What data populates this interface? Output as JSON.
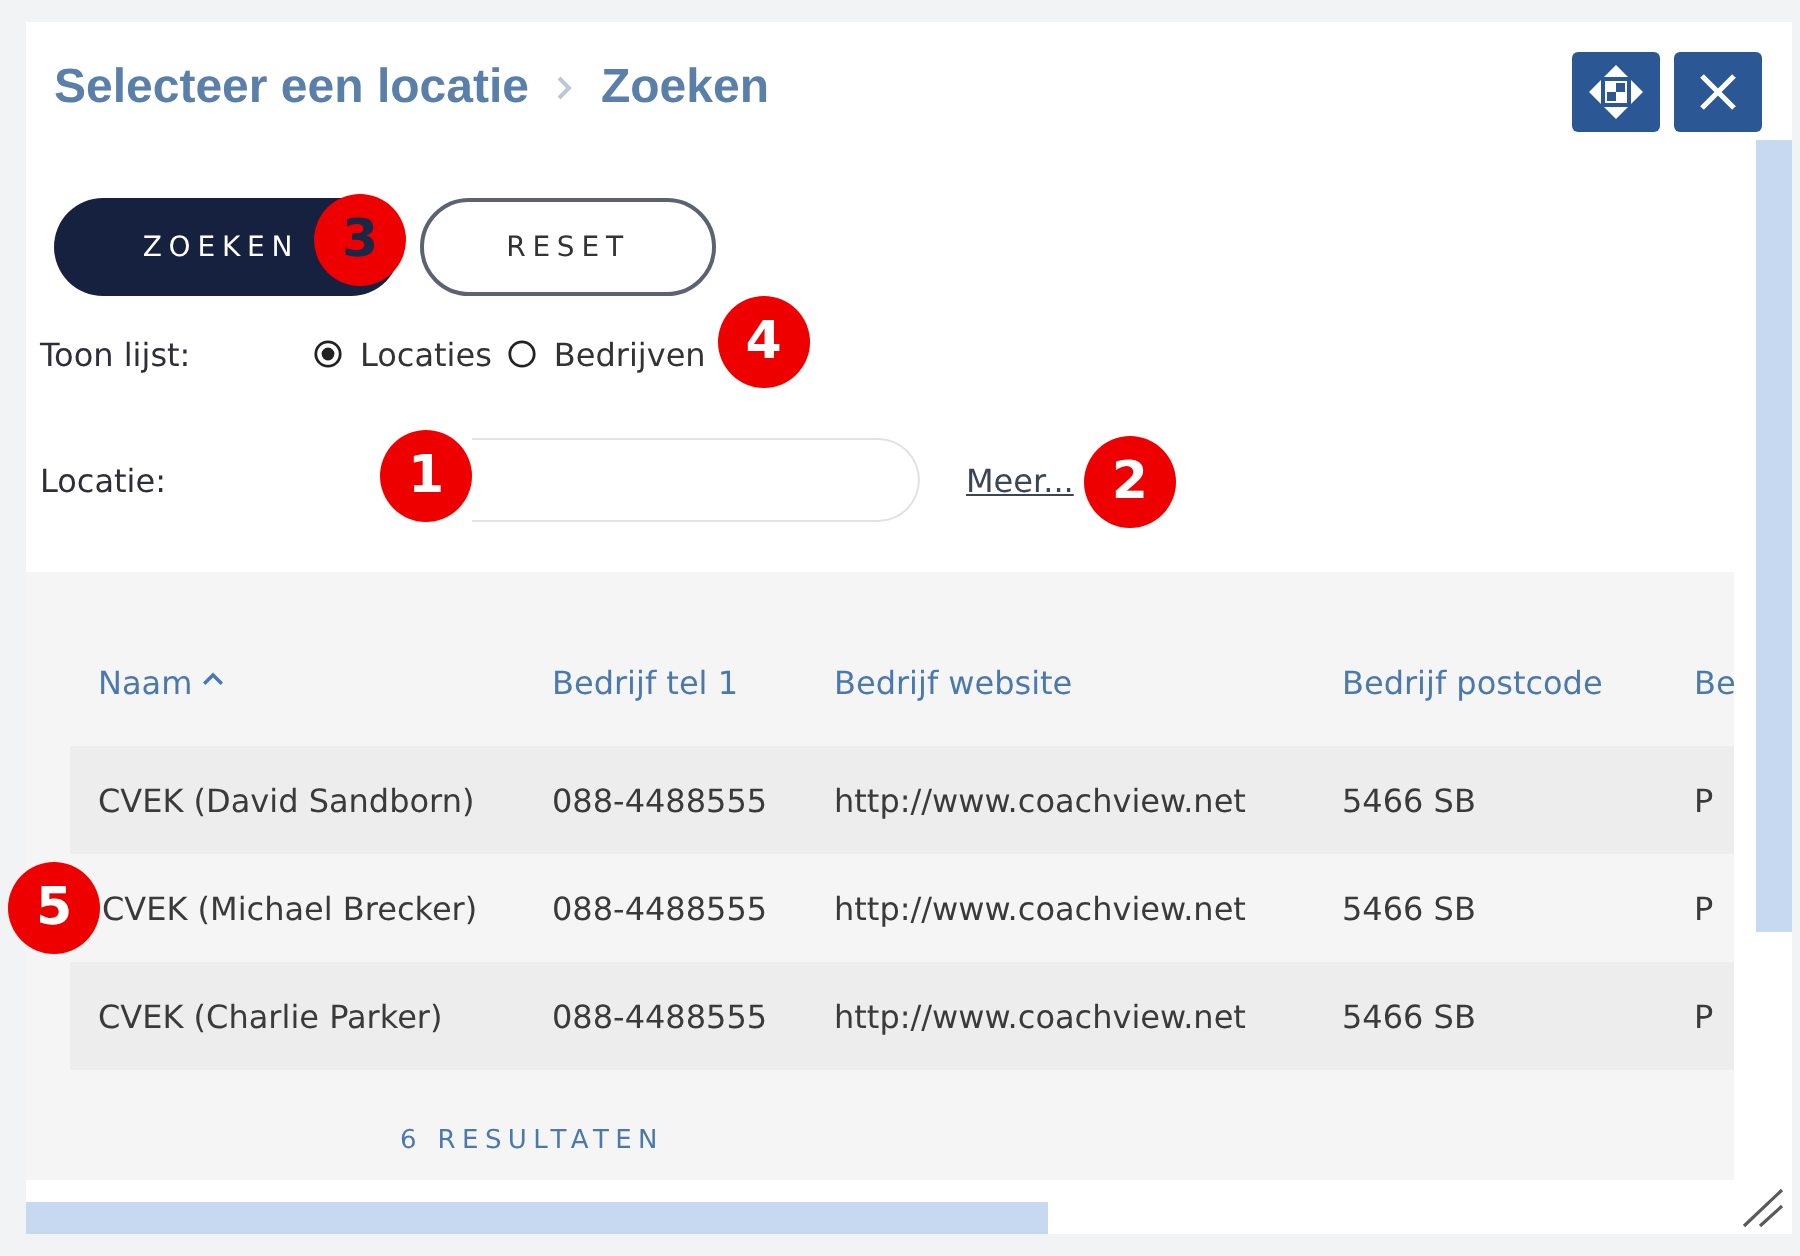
{
  "dialog": {
    "breadcrumb": [
      {
        "label": "Selecteer een locatie"
      },
      {
        "label": "Zoeken"
      }
    ]
  },
  "toolbar": {
    "buttons": [
      {
        "label": "ZOEKEN",
        "kind": "primary",
        "badge": "3"
      },
      {
        "label": "RESET",
        "kind": "secondary"
      }
    ]
  },
  "list_choice": {
    "label": "Toon lijst:",
    "options": [
      {
        "label": "Locaties",
        "selected": true
      },
      {
        "label": "Bedrijven",
        "selected": false
      }
    ],
    "badge": "4"
  },
  "location_field": {
    "label": "Locatie:",
    "badge": "1",
    "more_link": {
      "label": "Meer...",
      "badge": "2"
    }
  },
  "table": {
    "columns": [
      {
        "label": "Naam",
        "sorted": true
      },
      {
        "label": "Bedrijf tel 1",
        "sorted": false
      },
      {
        "label": "Bedrijf website",
        "sorted": false
      },
      {
        "label": "Bedrijf postcode",
        "sorted": false
      },
      {
        "label": "Be",
        "sorted": false
      }
    ],
    "rows": [
      {
        "cells": [
          "CVEK (David Sandborn)",
          "088-4488555",
          "http://www.coachview.net",
          "5466 SB",
          "P"
        ]
      },
      {
        "cells": [
          "CVEK (Michael Brecker)",
          "088-4488555",
          "http://www.coachview.net",
          "5466 SB",
          "P"
        ],
        "badge": "5"
      },
      {
        "cells": [
          "CVEK (Charlie Parker)",
          "088-4488555",
          "http://www.coachview.net",
          "5466 SB",
          "P"
        ]
      }
    ],
    "footer": "6 RESULTATEN"
  }
}
